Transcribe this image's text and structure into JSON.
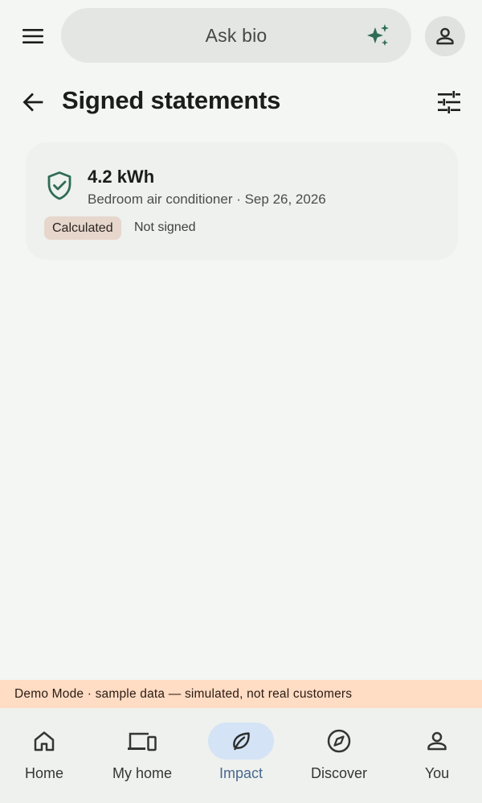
{
  "search": {
    "placeholder": "Ask bio"
  },
  "page": {
    "title": "Signed statements"
  },
  "statements": [
    {
      "amount": "4.2 kWh",
      "meta": "Bedroom air conditioner · Sep 26, 2026",
      "chip": "Calculated",
      "status": "Not signed"
    }
  ],
  "banner": {
    "text": "Demo Mode · sample data — simulated, not real customers"
  },
  "nav": {
    "items": [
      {
        "label": "Home",
        "icon": "home-icon"
      },
      {
        "label": "My home",
        "icon": "devices-icon"
      },
      {
        "label": "Impact",
        "icon": "leaf-icon",
        "active": true
      },
      {
        "label": "Discover",
        "icon": "compass-icon"
      },
      {
        "label": "You",
        "icon": "person-icon"
      }
    ]
  },
  "colors": {
    "accent": "#2f6b57",
    "active_nav_bg": "#d4e3f5",
    "active_nav_text": "#4a6790",
    "banner_bg": "#ffdcc4",
    "chip_bg": "#e6d6cc"
  }
}
